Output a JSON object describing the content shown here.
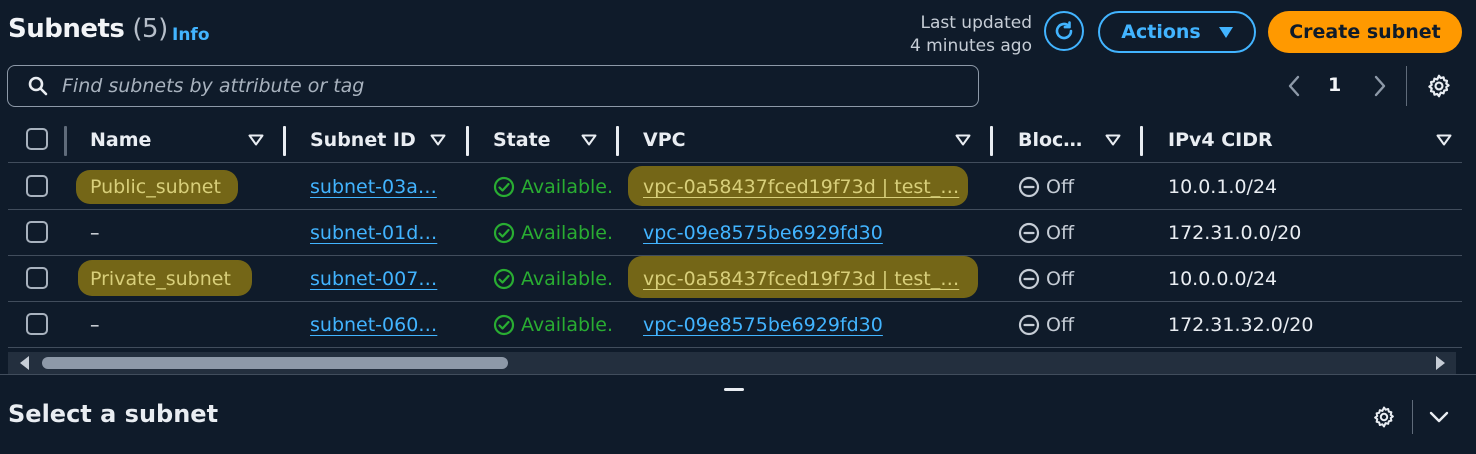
{
  "header": {
    "title": "Subnets",
    "count": "(5)",
    "info": "Info",
    "last_updated_line1": "Last updated",
    "last_updated_line2": "4 minutes ago",
    "actions_label": "Actions",
    "create_label": "Create subnet"
  },
  "search": {
    "placeholder": "Find subnets by attribute or tag"
  },
  "pagination": {
    "page": "1"
  },
  "columns": {
    "name": "Name",
    "subnet_id": "Subnet ID",
    "state": "State",
    "vpc": "VPC",
    "block": "Bloc…",
    "ipv4": "IPv4 CIDR"
  },
  "rows": [
    {
      "name": "Public_subnet",
      "subnet_id": "subnet-03a…",
      "state": "Available.",
      "vpc": "vpc-0a58437fced19f73d | test_…",
      "block": "Off",
      "ipv4": "10.0.1.0/24"
    },
    {
      "name": "–",
      "subnet_id": "subnet-01d…",
      "state": "Available.",
      "vpc": "vpc-09e8575be6929fd30",
      "block": "Off",
      "ipv4": "172.31.0.0/20"
    },
    {
      "name": "Private_subnet",
      "subnet_id": "subnet-007…",
      "state": "Available.",
      "vpc": "vpc-0a58437fced19f73d | test_…",
      "block": "Off",
      "ipv4": "10.0.0.0/24"
    },
    {
      "name": "–",
      "subnet_id": "subnet-060…",
      "state": "Available.",
      "vpc": "vpc-09e8575be6929fd30",
      "block": "Off",
      "ipv4": "172.31.32.0/20"
    }
  ],
  "detail": {
    "title": "Select a subnet"
  },
  "colors": {
    "background": "#0f1b2a",
    "link": "#42b4ff",
    "primary": "#ff9900",
    "success": "#29ad32",
    "highlight": "#7a6a16"
  },
  "icons": [
    "refresh-icon",
    "caret-down-icon",
    "search-icon",
    "chevron-left-icon",
    "chevron-right-icon",
    "gear-icon",
    "sort-caret-icon",
    "check-circle-icon",
    "minus-circle-icon",
    "chevron-down-icon"
  ]
}
